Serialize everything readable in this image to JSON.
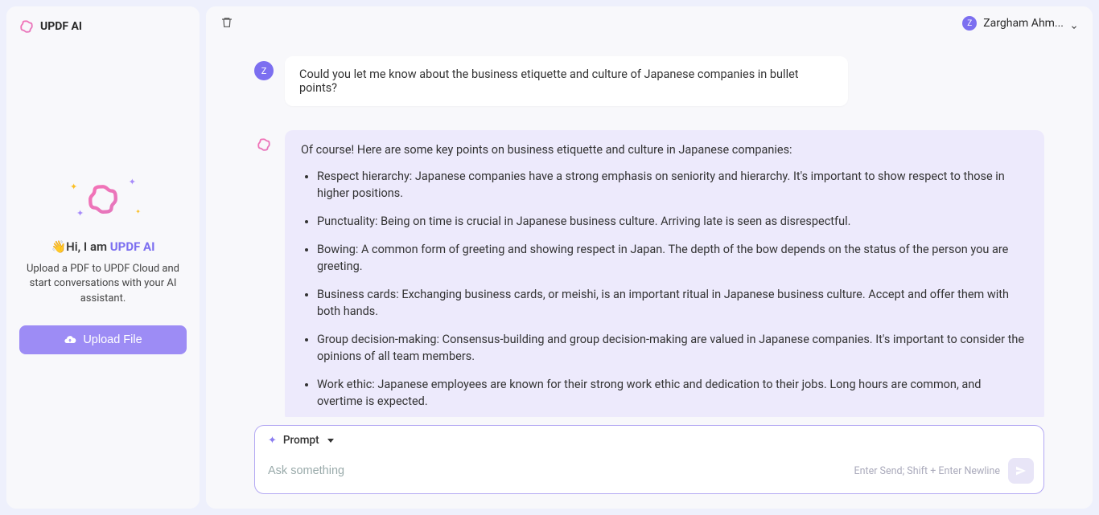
{
  "sidebar": {
    "title": "UPDF AI",
    "greeting_prefix": "👋Hi, I am ",
    "greeting_brand": "UPDF AI",
    "description": "Upload a PDF to UPDF Cloud and start conversations with your AI assistant.",
    "upload_label": "Upload File"
  },
  "header": {
    "user_name": "Zargham Ahm...",
    "user_initial": "Z"
  },
  "chat": {
    "user_initial": "Z",
    "user_message": "Could you let me know about the business etiquette and culture of Japanese companies in bullet points?",
    "ai_intro": "Of course! Here are some key points on business etiquette and culture in Japanese companies:",
    "ai_points": [
      "Respect hierarchy: Japanese companies have a strong emphasis on seniority and hierarchy. It's important to show respect to those in higher positions.",
      "Punctuality: Being on time is crucial in Japanese business culture. Arriving late is seen as disrespectful.",
      "Bowing: A common form of greeting and showing respect in Japan. The depth of the bow depends on the status of the person you are greeting.",
      "Business cards: Exchanging business cards, or meishi, is an important ritual in Japanese business culture. Accept and offer them with both hands.",
      "Group decision-making: Consensus-building and group decision-making are valued in Japanese companies. It's important to consider the opinions of all team members.",
      "Work ethic: Japanese employees are known for their strong work ethic and dedication to their jobs. Long hours are common, and overtime is expected."
    ]
  },
  "input": {
    "prompt_label": "Prompt",
    "placeholder": "Ask something",
    "hint": "Enter Send; Shift + Enter Newline"
  }
}
